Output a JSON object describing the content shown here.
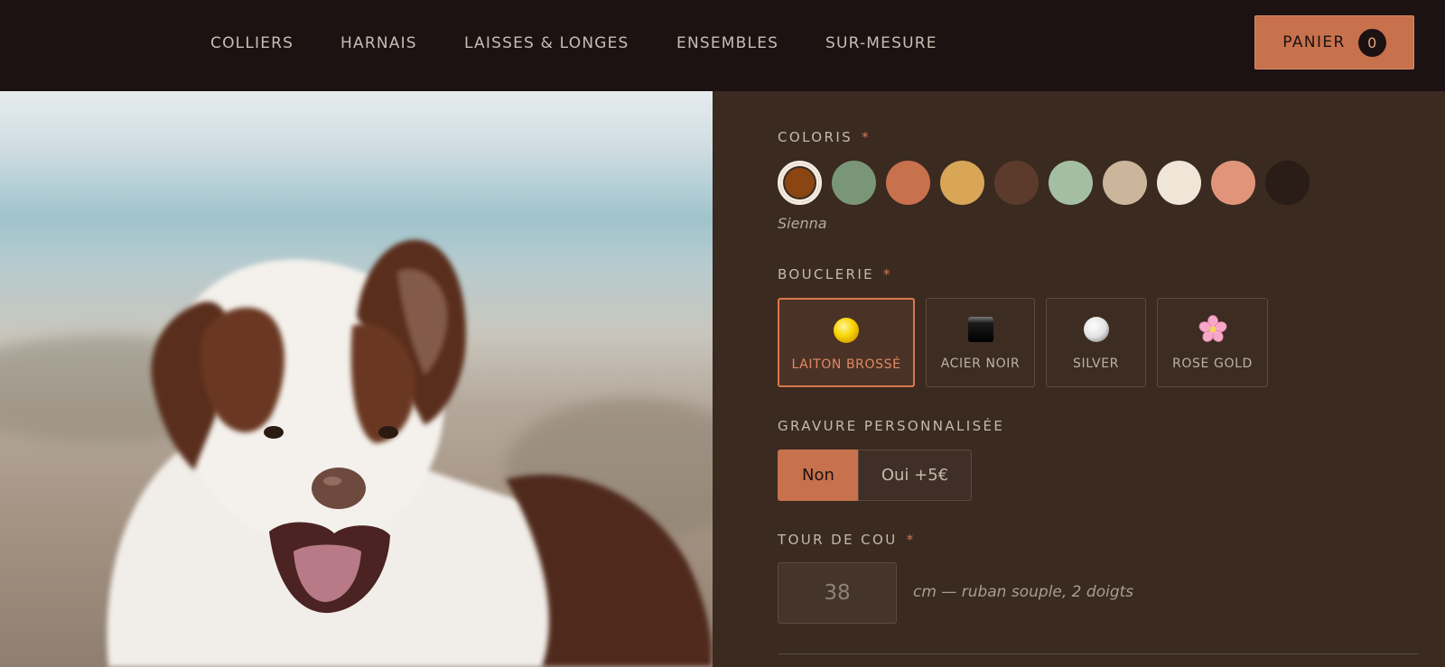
{
  "nav": {
    "items": [
      "COLLIERS",
      "HARNAIS",
      "LAISSES & LONGES",
      "ENSEMBLES",
      "SUR-MESURE"
    ]
  },
  "cart": {
    "label": "PANIER",
    "count": "0"
  },
  "options": {
    "color": {
      "label": "COLORIS",
      "required_mark": "*",
      "selected_name": "Sienna",
      "swatches": [
        "#8b4513",
        "#7a9678",
        "#c8714d",
        "#d9a657",
        "#5c3b2c",
        "#a4bea1",
        "#cbb69c",
        "#efe6d8",
        "#e0957a",
        "#2a1c16"
      ]
    },
    "buckle": {
      "label": "BOUCLERIE",
      "required_mark": "*",
      "items": [
        {
          "name": "LAITON BROSSÉ",
          "icon": "yellow-circle-icon"
        },
        {
          "name": "ACIER NOIR",
          "icon": "black-square-icon"
        },
        {
          "name": "SILVER",
          "icon": "white-circle-icon"
        },
        {
          "name": "ROSE GOLD",
          "icon": "cherry-blossom-icon"
        }
      ]
    },
    "engraving": {
      "label": "GRAVURE PERSONNALISÉE",
      "no": "Non",
      "yes": "Oui +5€"
    },
    "neck": {
      "label": "TOUR DE COU",
      "required_mark": "*",
      "value": "38",
      "hint": "cm — ruban souple, 2 doigts"
    }
  }
}
